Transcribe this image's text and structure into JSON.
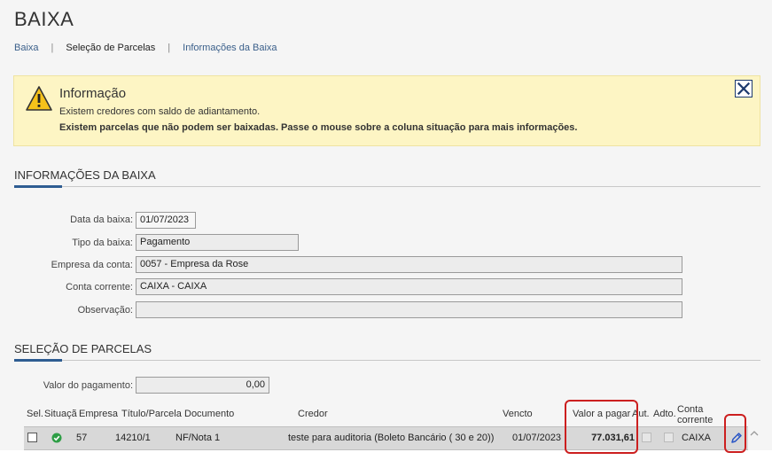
{
  "page": {
    "title": "BAIXA"
  },
  "breadcrumb": [
    "Baixa",
    "Seleção de Parcelas",
    "Informações da Baixa"
  ],
  "info": {
    "heading": "Informação",
    "line1": "Existem credores com saldo de adiantamento.",
    "line2": "Existem parcelas que não podem ser baixadas. Passe o mouse sobre a coluna situação para mais informações."
  },
  "info_baixa": {
    "title": "INFORMAÇÕES DA BAIXA",
    "data_label": "Data da baixa:",
    "data_value": "01/07/2023",
    "tipo_label": "Tipo da baixa:",
    "tipo_value": "Pagamento",
    "empresa_label": "Empresa da conta:",
    "empresa_value": "0057 - Empresa da Rose",
    "conta_label": "Conta corrente:",
    "conta_value": "CAIXA - CAIXA",
    "obs_label": "Observação:",
    "obs_value": ""
  },
  "selecao": {
    "title": "SELEÇÃO DE PARCELAS",
    "valor_label": "Valor do pagamento:",
    "valor_value": "0,00",
    "columns": {
      "sel": "Sel.",
      "situacao": "Situaçã",
      "empresa": "Empresa",
      "titulo": "Título/Parcela",
      "documento": "Documento",
      "credor": "Credor",
      "vencto": "Vencto",
      "valor": "Valor a pagar",
      "aut": "Aut.",
      "adto": "Adto.",
      "conta_line1": "Conta",
      "conta_line2": "corrente"
    },
    "rows": [
      {
        "empresa": "57",
        "titulo": "14210/1",
        "documento": "NF/Nota 1",
        "credor": "teste para auditoria (Boleto Bancário ( 30 e 20))",
        "vencto": "01/07/2023",
        "valor": "77.031,61",
        "conta": "CAIXA"
      }
    ]
  },
  "colors": {
    "accent": "#2e5d92",
    "highlight": "#cc1f1f",
    "ok": "#2e9e46",
    "warning_bg": "#fdf5c4"
  }
}
